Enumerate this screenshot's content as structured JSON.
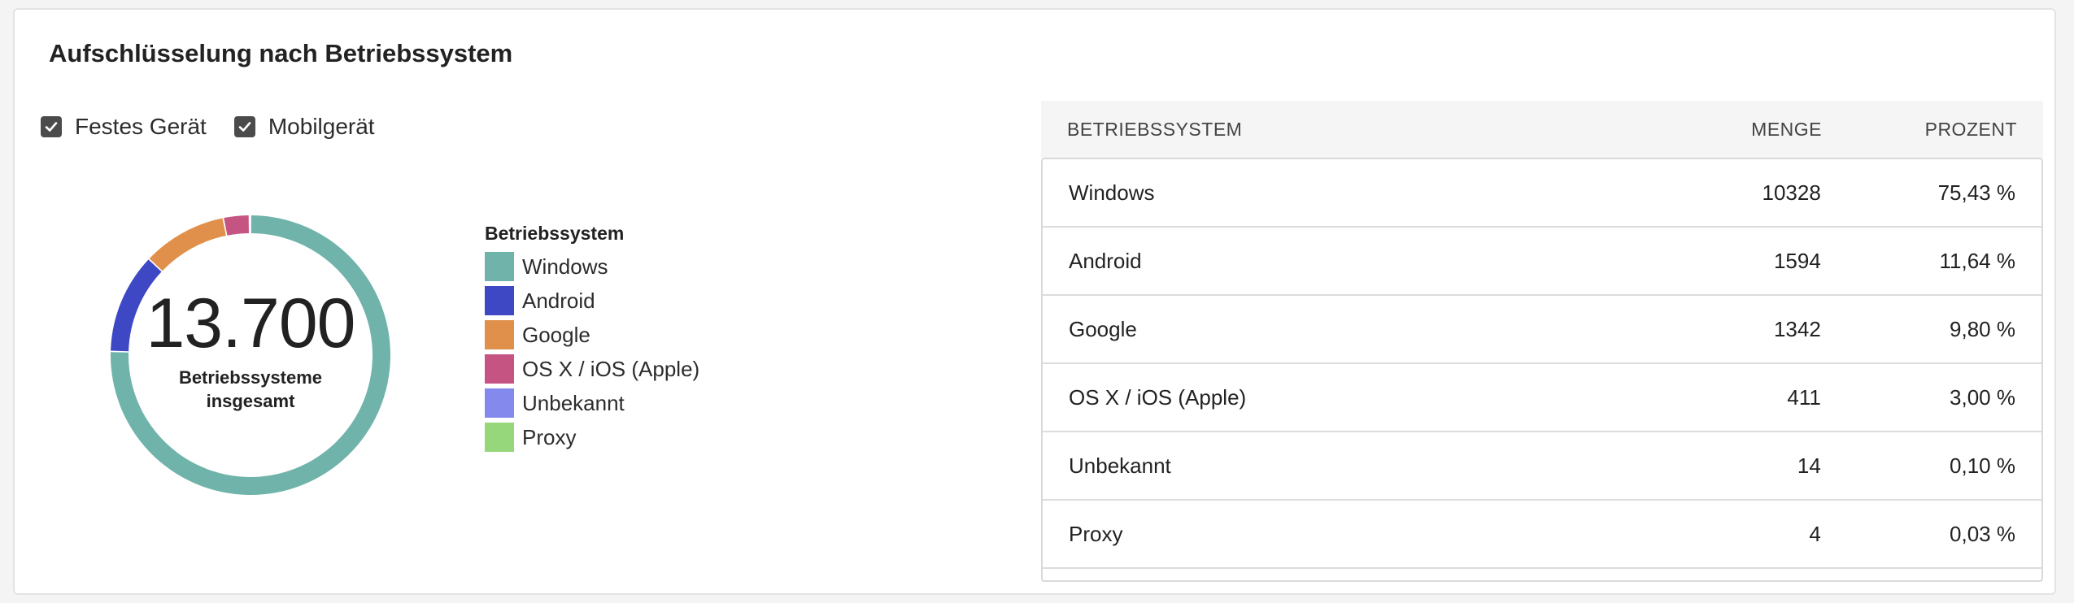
{
  "title": "Aufschlüsselung nach Betriebssystem",
  "filters": [
    {
      "label": "Festes Gerät",
      "checked": true
    },
    {
      "label": "Mobilgerät",
      "checked": true
    }
  ],
  "donut": {
    "total": "13.700",
    "caption": "Betriebssysteme insgesamt"
  },
  "legend": {
    "title": "Betriebssystem",
    "items": [
      {
        "label": "Windows",
        "color": "#6fb3aa"
      },
      {
        "label": "Android",
        "color": "#3f48c4"
      },
      {
        "label": "Google",
        "color": "#e0904a"
      },
      {
        "label": "OS X / iOS (Apple)",
        "color": "#c65483"
      },
      {
        "label": "Unbekannt",
        "color": "#8489ee"
      },
      {
        "label": "Proxy",
        "color": "#97d77c"
      }
    ]
  },
  "table": {
    "headers": [
      "BETRIEBSSYSTEM",
      "MENGE",
      "PROZENT"
    ],
    "rows": [
      {
        "os": "Windows",
        "menge": "10328",
        "prozent": "75,43 %"
      },
      {
        "os": "Android",
        "menge": "1594",
        "prozent": "11,64 %"
      },
      {
        "os": "Google",
        "menge": "1342",
        "prozent": "9,80 %"
      },
      {
        "os": "OS X / iOS (Apple)",
        "menge": "411",
        "prozent": "3,00 %"
      },
      {
        "os": "Unbekannt",
        "menge": "14",
        "prozent": "0,10 %"
      },
      {
        "os": "Proxy",
        "menge": "4",
        "prozent": "0,03 %"
      }
    ]
  },
  "chart_data": {
    "type": "pie",
    "categories": [
      "Windows",
      "Android",
      "Google",
      "OS X / iOS (Apple)",
      "Unbekannt",
      "Proxy"
    ],
    "values": [
      10328,
      1594,
      1342,
      411,
      14,
      4
    ],
    "colors": [
      "#6fb3aa",
      "#3f48c4",
      "#e0904a",
      "#c65483",
      "#8489ee",
      "#97d77c"
    ],
    "legend": "right"
  }
}
